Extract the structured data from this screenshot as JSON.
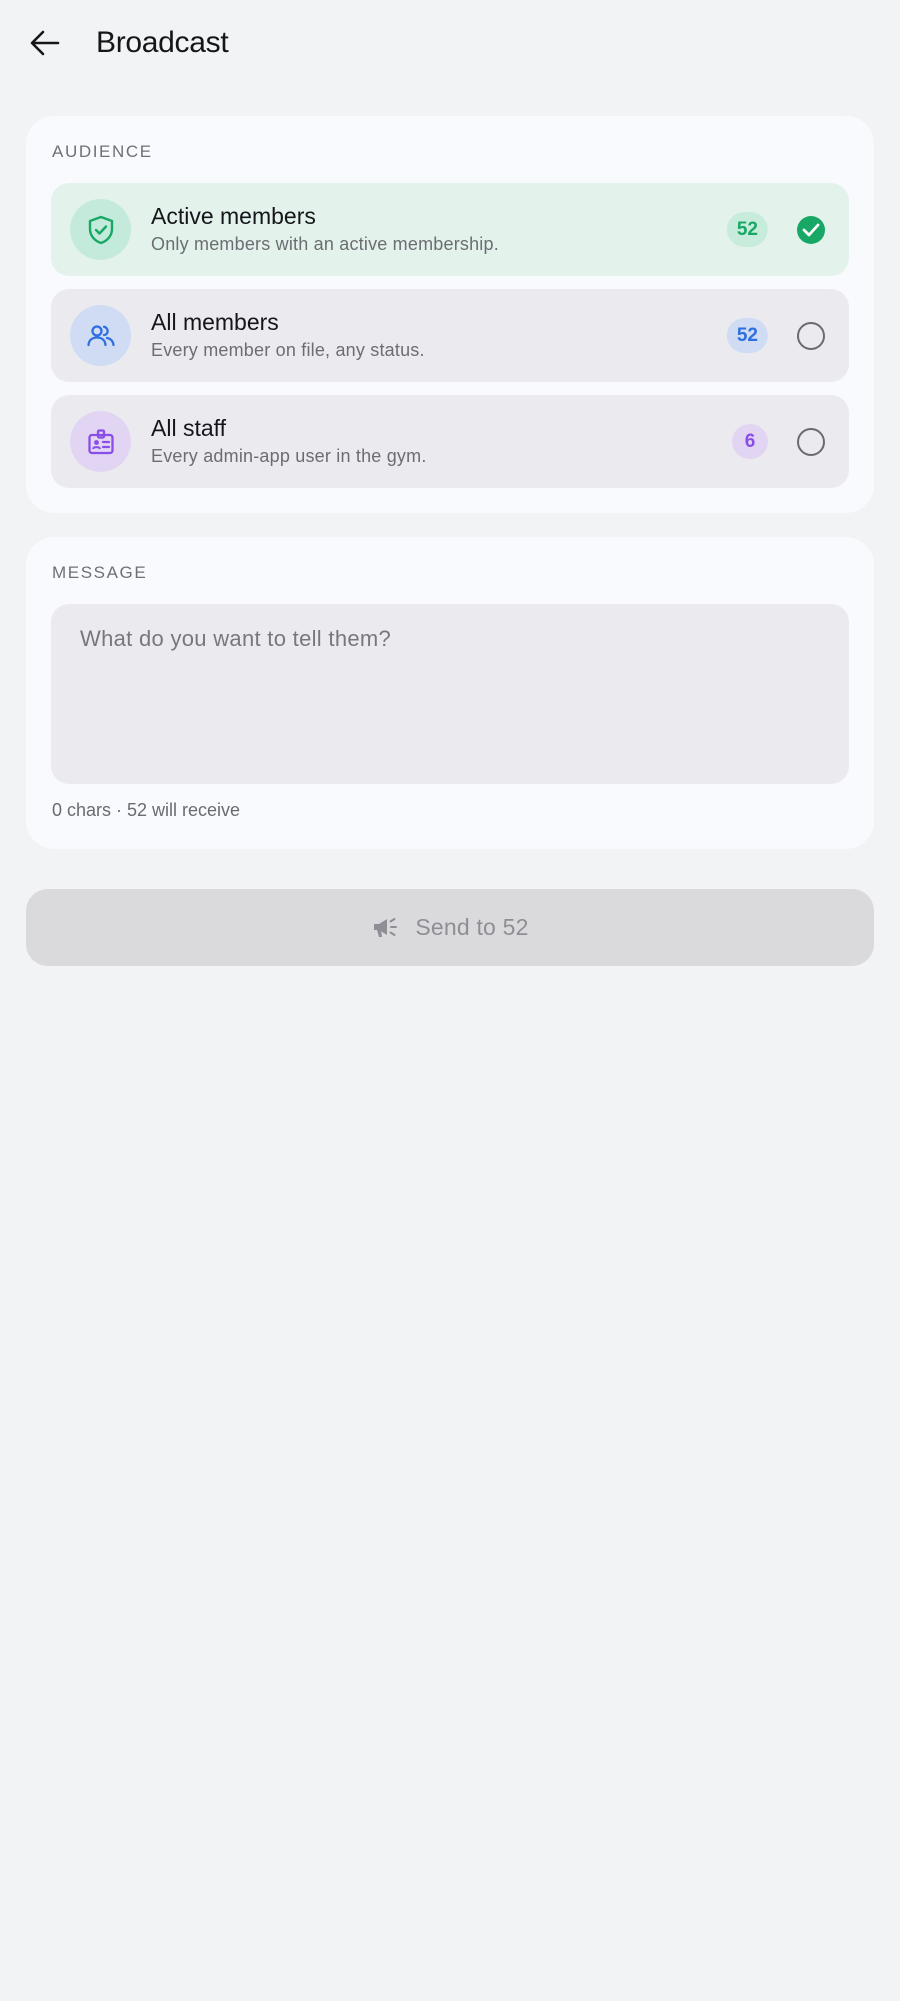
{
  "header": {
    "title": "Broadcast"
  },
  "audience": {
    "label": "AUDIENCE",
    "options": [
      {
        "title": "Active members",
        "subtitle": "Only members with an active membership.",
        "count": "52",
        "selected": true,
        "icon": "shield-check-icon"
      },
      {
        "title": "All members",
        "subtitle": "Every member on file, any status.",
        "count": "52",
        "selected": false,
        "icon": "people-icon"
      },
      {
        "title": "All staff",
        "subtitle": "Every admin-app user in the gym.",
        "count": "6",
        "selected": false,
        "icon": "badge-icon"
      }
    ]
  },
  "message": {
    "label": "MESSAGE",
    "placeholder": "What do you want to tell them?",
    "value": "",
    "status": "0 chars · 52 will receive"
  },
  "send": {
    "label": "Send to 52",
    "icon": "megaphone-icon"
  },
  "colors": {
    "green": "#18a865",
    "blue": "#2f6fe0",
    "purple": "#8a4de8"
  }
}
